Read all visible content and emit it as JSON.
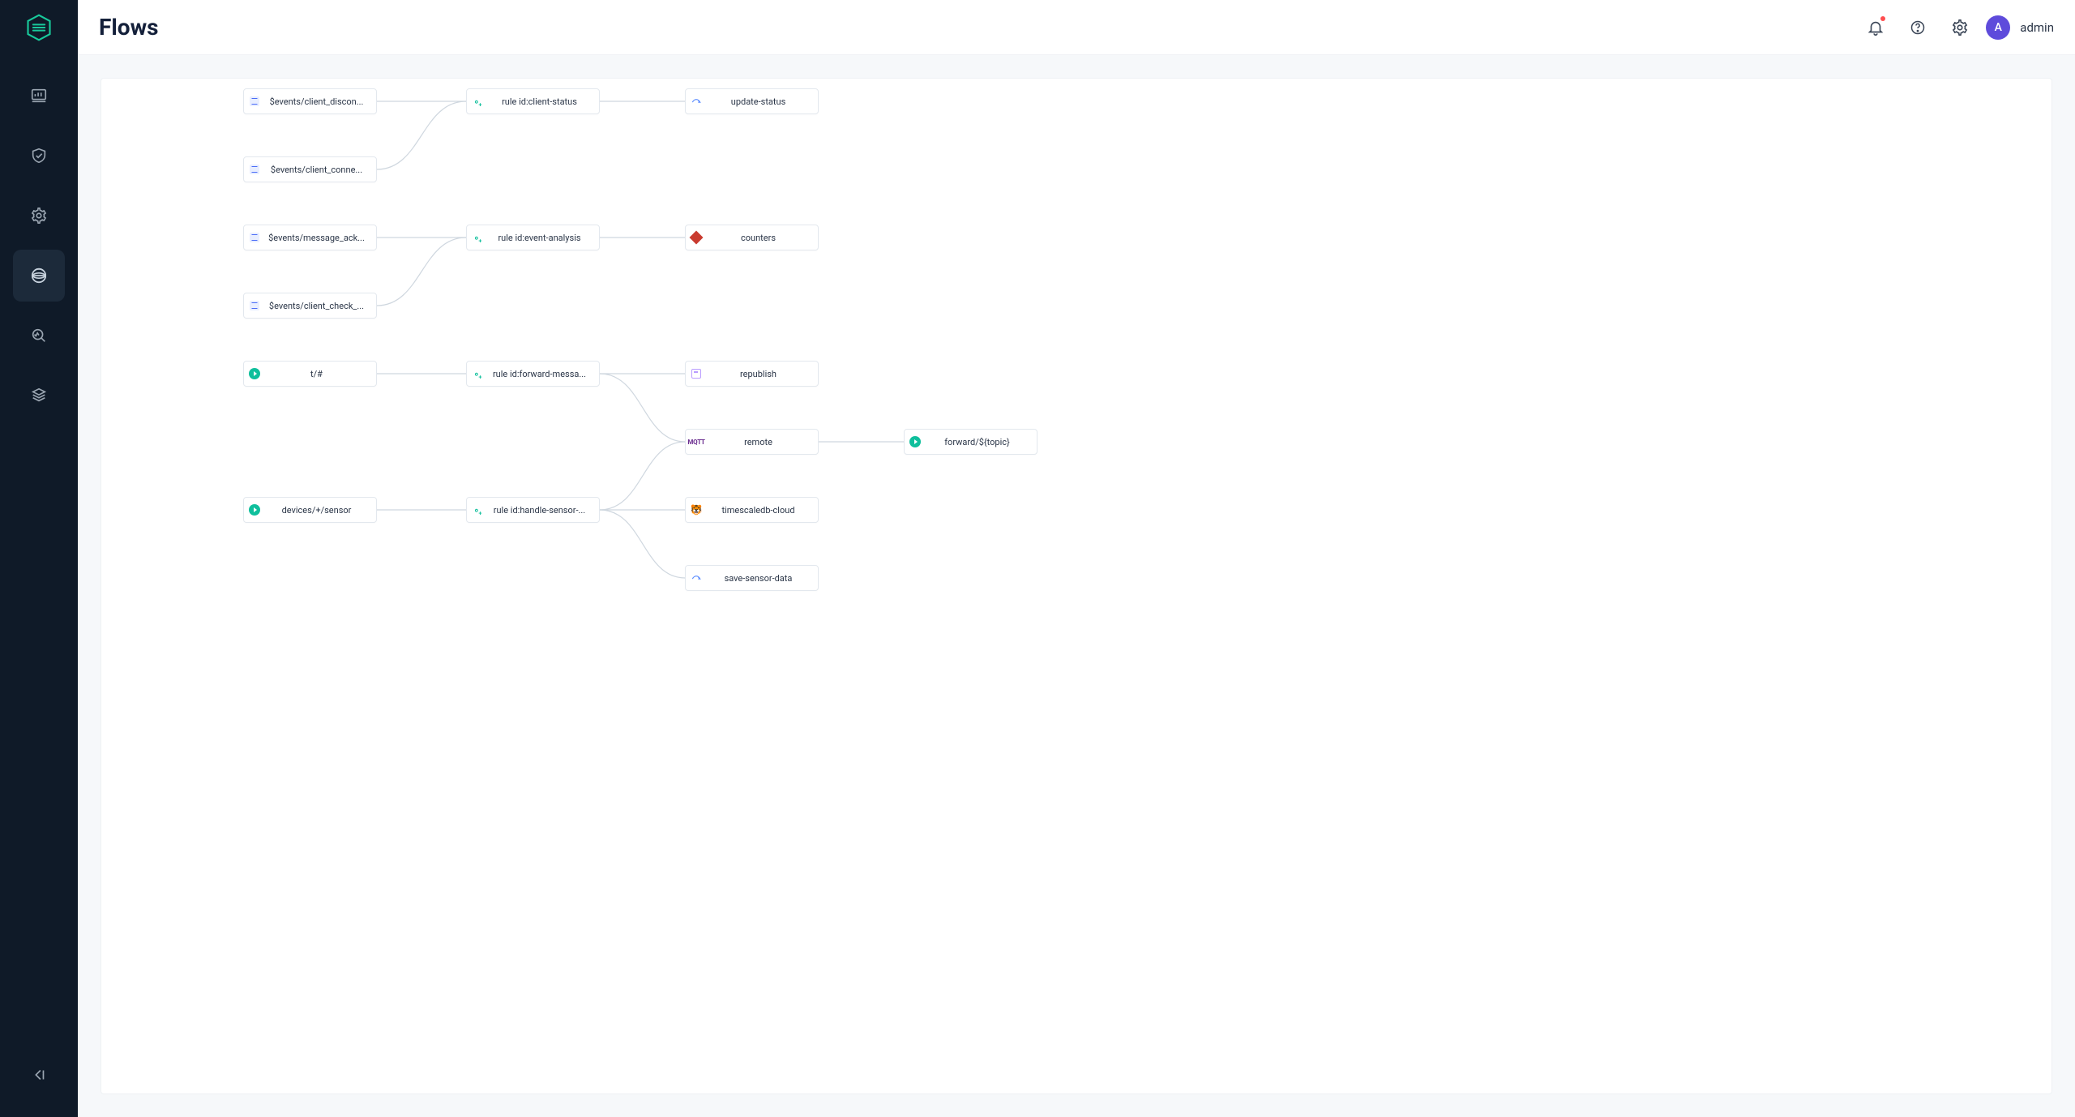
{
  "header": {
    "title": "Flows",
    "avatar_letter": "A",
    "username": "admin"
  },
  "sidebar": {},
  "nodes": {
    "n_disc": {
      "label": "$events/client_discon..."
    },
    "n_conn": {
      "label": "$events/client_conne..."
    },
    "n_ack": {
      "label": "$events/message_ack..."
    },
    "n_check": {
      "label": "$events/client_check_..."
    },
    "n_t": {
      "label": "t/#"
    },
    "n_dev": {
      "label": "devices/+/sensor"
    },
    "r_status": {
      "label": "rule id:client-status"
    },
    "r_event": {
      "label": "rule id:event-analysis"
    },
    "r_forward": {
      "label": "rule id:forward-messa..."
    },
    "r_sensor": {
      "label": "rule id:handle-sensor-..."
    },
    "a_update": {
      "label": "update-status"
    },
    "a_counters": {
      "label": "counters"
    },
    "a_repub": {
      "label": "republish"
    },
    "a_remote": {
      "label": "remote"
    },
    "a_ts": {
      "label": "timescaledb-cloud"
    },
    "a_save": {
      "label": "save-sensor-data"
    },
    "o_forward": {
      "label": "forward/${topic}"
    }
  }
}
